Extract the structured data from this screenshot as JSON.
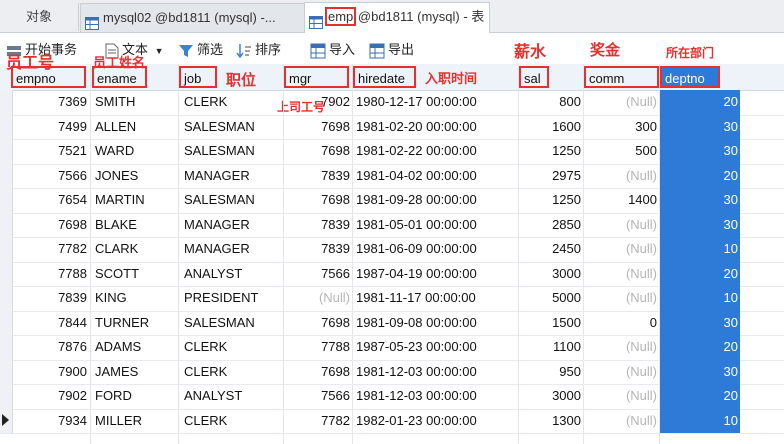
{
  "tabs": {
    "objects": "对象",
    "tab1": "mysql02 @bd1811 (mysql) -...",
    "tab2_table": "emp",
    "tab2_rest": " @bd1811 (mysql) - 表"
  },
  "toolbar": {
    "begin_transaction": "开始事务",
    "text": "文本",
    "filter": "筛选",
    "sort": "排序",
    "import": "导入",
    "export": "导出"
  },
  "columns": [
    "empno",
    "ename",
    "job",
    "mgr",
    "hiredate",
    "sal",
    "comm",
    "deptno"
  ],
  "annotations": {
    "empno": "员工号",
    "ename": "员工姓名",
    "job": "职位",
    "mgr": "上司工号",
    "hiredate": "入职时间",
    "sal": "薪水",
    "comm": "奖金",
    "deptno": "所在部门"
  },
  "rows": [
    {
      "empno": "7369",
      "ename": "SMITH",
      "job": "CLERK",
      "mgr": "7902",
      "hiredate": "1980-12-17 00:00:00",
      "sal": "800",
      "comm": "(Null)",
      "deptno": "20"
    },
    {
      "empno": "7499",
      "ename": "ALLEN",
      "job": "SALESMAN",
      "mgr": "7698",
      "hiredate": "1981-02-20 00:00:00",
      "sal": "1600",
      "comm": "300",
      "deptno": "30"
    },
    {
      "empno": "7521",
      "ename": "WARD",
      "job": "SALESMAN",
      "mgr": "7698",
      "hiredate": "1981-02-22 00:00:00",
      "sal": "1250",
      "comm": "500",
      "deptno": "30"
    },
    {
      "empno": "7566",
      "ename": "JONES",
      "job": "MANAGER",
      "mgr": "7839",
      "hiredate": "1981-04-02 00:00:00",
      "sal": "2975",
      "comm": "(Null)",
      "deptno": "20"
    },
    {
      "empno": "7654",
      "ename": "MARTIN",
      "job": "SALESMAN",
      "mgr": "7698",
      "hiredate": "1981-09-28 00:00:00",
      "sal": "1250",
      "comm": "1400",
      "deptno": "30"
    },
    {
      "empno": "7698",
      "ename": "BLAKE",
      "job": "MANAGER",
      "mgr": "7839",
      "hiredate": "1981-05-01 00:00:00",
      "sal": "2850",
      "comm": "(Null)",
      "deptno": "30"
    },
    {
      "empno": "7782",
      "ename": "CLARK",
      "job": "MANAGER",
      "mgr": "7839",
      "hiredate": "1981-06-09 00:00:00",
      "sal": "2450",
      "comm": "(Null)",
      "deptno": "10"
    },
    {
      "empno": "7788",
      "ename": "SCOTT",
      "job": "ANALYST",
      "mgr": "7566",
      "hiredate": "1987-04-19 00:00:00",
      "sal": "3000",
      "comm": "(Null)",
      "deptno": "20"
    },
    {
      "empno": "7839",
      "ename": "KING",
      "job": "PRESIDENT",
      "mgr": "(Null)",
      "hiredate": "1981-11-17 00:00:00",
      "sal": "5000",
      "comm": "(Null)",
      "deptno": "10"
    },
    {
      "empno": "7844",
      "ename": "TURNER",
      "job": "SALESMAN",
      "mgr": "7698",
      "hiredate": "1981-09-08 00:00:00",
      "sal": "1500",
      "comm": "0",
      "deptno": "30"
    },
    {
      "empno": "7876",
      "ename": "ADAMS",
      "job": "CLERK",
      "mgr": "7788",
      "hiredate": "1987-05-23 00:00:00",
      "sal": "1100",
      "comm": "(Null)",
      "deptno": "20"
    },
    {
      "empno": "7900",
      "ename": "JAMES",
      "job": "CLERK",
      "mgr": "7698",
      "hiredate": "1981-12-03 00:00:00",
      "sal": "950",
      "comm": "(Null)",
      "deptno": "30"
    },
    {
      "empno": "7902",
      "ename": "FORD",
      "job": "ANALYST",
      "mgr": "7566",
      "hiredate": "1981-12-03 00:00:00",
      "sal": "3000",
      "comm": "(Null)",
      "deptno": "20"
    },
    {
      "empno": "7934",
      "ename": "MILLER",
      "job": "CLERK",
      "mgr": "7782",
      "hiredate": "1982-01-23 00:00:00",
      "sal": "1300",
      "comm": "(Null)",
      "deptno": "10"
    }
  ],
  "current_row_index": 13,
  "colors": {
    "selection": "#2d7bd6",
    "annotation": "#e53030",
    "null": "#b5b5b5"
  }
}
